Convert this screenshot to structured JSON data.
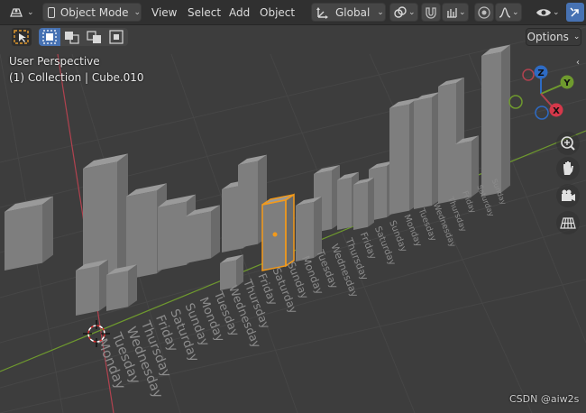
{
  "header": {
    "mode_label": "Object Mode",
    "menu": [
      "View",
      "Select",
      "Add",
      "Object"
    ],
    "orientation_label": "Global"
  },
  "toolbar": {
    "options_label": "Options"
  },
  "viewport": {
    "perspective_label": "User Perspective",
    "collection_label": "(1) Collection | Cube.010",
    "watermark": "CSDN @aiw2s",
    "gizmo": {
      "z_label": "Z",
      "y_label": "Y",
      "x_label": "X"
    },
    "day_labels": [
      "Monday",
      "Tuesday",
      "Wednesday",
      "Thursday",
      "Friday",
      "Saturday",
      "Sunday",
      "Monday",
      "Tuesday",
      "Wednesday",
      "Thursday",
      "Friday",
      "Saturday",
      "Sunday",
      "Monday",
      "Tuesday",
      "Wednesday",
      "Thursday",
      "Friday",
      "Saturday",
      "Sunday",
      "Monday",
      "Tuesday",
      "Wednesday",
      "Thursday",
      "Friday",
      "Saturday",
      "Sunday"
    ]
  },
  "colors": {
    "header_bg": "#303030",
    "viewport_bg": "#3d3d3d",
    "grid_line": "#454545",
    "x_axis": "#b1424f",
    "y_axis": "#6f9a2e",
    "selection_orange": "#f39a1b",
    "bar_top": "#9a9a9a",
    "bar_front": "#7e7e7e",
    "bar_side": "#6a6a6a",
    "accent_blue": "#4772b3"
  }
}
